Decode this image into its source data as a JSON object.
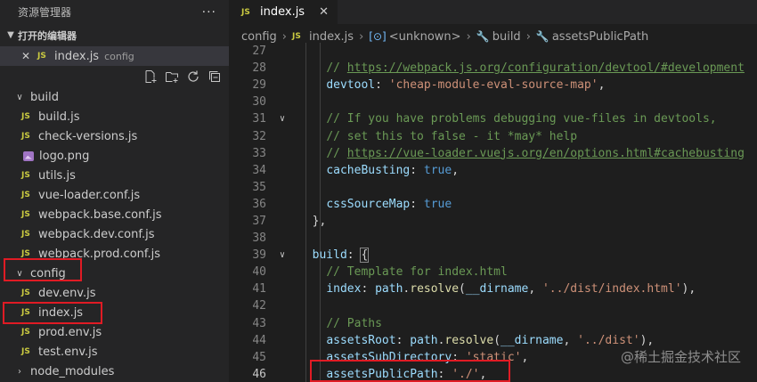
{
  "sidebar": {
    "title": "资源管理器",
    "more_icon": "···",
    "open_editors": {
      "label": "打开的编辑器",
      "items": [
        {
          "name": "index.js",
          "desc": "config"
        }
      ]
    },
    "tree": [
      {
        "type": "folder",
        "name": "build",
        "expanded": true
      },
      {
        "type": "js",
        "name": "build.js"
      },
      {
        "type": "js",
        "name": "check-versions.js"
      },
      {
        "type": "img",
        "name": "logo.png"
      },
      {
        "type": "js",
        "name": "utils.js"
      },
      {
        "type": "js",
        "name": "vue-loader.conf.js"
      },
      {
        "type": "js",
        "name": "webpack.base.conf.js"
      },
      {
        "type": "js",
        "name": "webpack.dev.conf.js"
      },
      {
        "type": "js",
        "name": "webpack.prod.conf.js"
      },
      {
        "type": "folder",
        "name": "config",
        "expanded": true
      },
      {
        "type": "js",
        "name": "dev.env.js"
      },
      {
        "type": "js",
        "name": "index.js"
      },
      {
        "type": "js",
        "name": "prod.env.js"
      },
      {
        "type": "js",
        "name": "test.env.js"
      },
      {
        "type": "folder",
        "name": "node_modules",
        "expanded": false
      }
    ]
  },
  "editor": {
    "tab": {
      "label": "index.js",
      "icon": "JS"
    },
    "breadcrumb": [
      "config",
      "index.js",
      "<unknown>",
      "build",
      "assetsPublicPath"
    ],
    "current_line": 46,
    "lines": [
      {
        "n": 27,
        "fold": false,
        "tokens": []
      },
      {
        "n": 28,
        "fold": false,
        "tokens": [
          {
            "t": "    "
          },
          {
            "t": "// ",
            "c": "c-com"
          },
          {
            "t": "https://webpack.js.org/configuration/devtool/#development",
            "c": "c-link"
          }
        ]
      },
      {
        "n": 29,
        "fold": false,
        "tokens": [
          {
            "t": "    "
          },
          {
            "t": "devtool",
            "c": "c-key"
          },
          {
            "t": ": ",
            "c": "c-pun"
          },
          {
            "t": "'cheap-module-eval-source-map'",
            "c": "c-str"
          },
          {
            "t": ",",
            "c": "c-pun"
          }
        ]
      },
      {
        "n": 30,
        "fold": false,
        "tokens": []
      },
      {
        "n": 31,
        "fold": true,
        "tokens": [
          {
            "t": "    "
          },
          {
            "t": "// If you have problems debugging vue-files in devtools,",
            "c": "c-com"
          }
        ]
      },
      {
        "n": 32,
        "fold": false,
        "tokens": [
          {
            "t": "    "
          },
          {
            "t": "// set this to false - it *may* help",
            "c": "c-com"
          }
        ]
      },
      {
        "n": 33,
        "fold": false,
        "tokens": [
          {
            "t": "    "
          },
          {
            "t": "// ",
            "c": "c-com"
          },
          {
            "t": "https://vue-loader.vuejs.org/en/options.html#cachebusting",
            "c": "c-link"
          }
        ]
      },
      {
        "n": 34,
        "fold": false,
        "tokens": [
          {
            "t": "    "
          },
          {
            "t": "cacheBusting",
            "c": "c-key"
          },
          {
            "t": ": ",
            "c": "c-pun"
          },
          {
            "t": "true",
            "c": "c-bool"
          },
          {
            "t": ",",
            "c": "c-pun"
          }
        ]
      },
      {
        "n": 35,
        "fold": false,
        "tokens": []
      },
      {
        "n": 36,
        "fold": false,
        "tokens": [
          {
            "t": "    "
          },
          {
            "t": "cssSourceMap",
            "c": "c-key"
          },
          {
            "t": ": ",
            "c": "c-pun"
          },
          {
            "t": "true",
            "c": "c-bool"
          }
        ]
      },
      {
        "n": 37,
        "fold": false,
        "tokens": [
          {
            "t": "  "
          },
          {
            "t": "},",
            "c": "c-pun"
          }
        ]
      },
      {
        "n": 38,
        "fold": false,
        "tokens": []
      },
      {
        "n": 39,
        "fold": true,
        "tokens": [
          {
            "t": "  "
          },
          {
            "t": "build",
            "c": "c-key"
          },
          {
            "t": ": ",
            "c": "c-pun"
          },
          {
            "t": "{",
            "c": "c-pun bracket-hl"
          }
        ]
      },
      {
        "n": 40,
        "fold": false,
        "tokens": [
          {
            "t": "    "
          },
          {
            "t": "// Template for index.html",
            "c": "c-com"
          }
        ]
      },
      {
        "n": 41,
        "fold": false,
        "tokens": [
          {
            "t": "    "
          },
          {
            "t": "index",
            "c": "c-key"
          },
          {
            "t": ": ",
            "c": "c-pun"
          },
          {
            "t": "path",
            "c": "c-key"
          },
          {
            "t": ".",
            "c": "c-pun"
          },
          {
            "t": "resolve",
            "c": "c-fn"
          },
          {
            "t": "(",
            "c": "c-pun"
          },
          {
            "t": "__dirname",
            "c": "c-key"
          },
          {
            "t": ", ",
            "c": "c-pun"
          },
          {
            "t": "'../dist/index.html'",
            "c": "c-str"
          },
          {
            "t": "),",
            "c": "c-pun"
          }
        ]
      },
      {
        "n": 42,
        "fold": false,
        "tokens": []
      },
      {
        "n": 43,
        "fold": false,
        "tokens": [
          {
            "t": "    "
          },
          {
            "t": "// Paths",
            "c": "c-com"
          }
        ]
      },
      {
        "n": 44,
        "fold": false,
        "tokens": [
          {
            "t": "    "
          },
          {
            "t": "assetsRoot",
            "c": "c-key"
          },
          {
            "t": ": ",
            "c": "c-pun"
          },
          {
            "t": "path",
            "c": "c-key"
          },
          {
            "t": ".",
            "c": "c-pun"
          },
          {
            "t": "resolve",
            "c": "c-fn"
          },
          {
            "t": "(",
            "c": "c-pun"
          },
          {
            "t": "__dirname",
            "c": "c-key"
          },
          {
            "t": ", ",
            "c": "c-pun"
          },
          {
            "t": "'../dist'",
            "c": "c-str"
          },
          {
            "t": "),",
            "c": "c-pun"
          }
        ]
      },
      {
        "n": 45,
        "fold": false,
        "tokens": [
          {
            "t": "    "
          },
          {
            "t": "assetsSubDirectory",
            "c": "c-key"
          },
          {
            "t": ": ",
            "c": "c-pun"
          },
          {
            "t": "'static'",
            "c": "c-str"
          },
          {
            "t": ",",
            "c": "c-pun"
          }
        ]
      },
      {
        "n": 46,
        "fold": false,
        "tokens": [
          {
            "t": "    "
          },
          {
            "t": "assetsPublicPath",
            "c": "c-key"
          },
          {
            "t": ": ",
            "c": "c-pun"
          },
          {
            "t": "'./'",
            "c": "c-str"
          },
          {
            "t": ",",
            "c": "c-pun"
          }
        ]
      }
    ]
  },
  "watermark": "@稀土掘金技术社区",
  "colors": {
    "highlight_box": "#e01b24",
    "js_icon": "#cbcb41"
  }
}
